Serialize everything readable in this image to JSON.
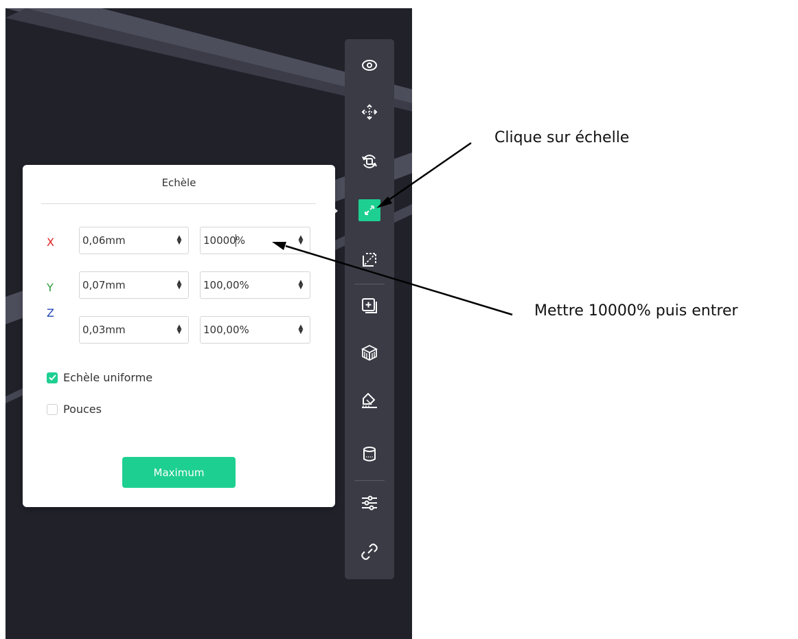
{
  "colors": {
    "accent": "#1ecf92",
    "viewport_bg": "#202129",
    "toolbar_bg": "#3a3b45",
    "axis_x": "#e02020",
    "axis_y": "#2a9a3a",
    "axis_z": "#2248b8"
  },
  "toolbar": {
    "tools": [
      {
        "name": "view",
        "icon": "eye-icon"
      },
      {
        "name": "move",
        "icon": "move-arrows-icon"
      },
      {
        "name": "rotate",
        "icon": "rotate-icon"
      },
      {
        "name": "scale",
        "icon": "scale-icon",
        "active": true
      },
      {
        "name": "mirror",
        "icon": "mirror-icon"
      },
      {
        "name": "add-part",
        "icon": "add-part-icon"
      },
      {
        "name": "supports",
        "icon": "supports-cube-icon"
      },
      {
        "name": "lay-flat",
        "icon": "lay-flat-icon"
      },
      {
        "name": "cylinder",
        "icon": "cylinder-icon"
      },
      {
        "name": "settings",
        "icon": "sliders-icon"
      },
      {
        "name": "link",
        "icon": "link-icon"
      }
    ]
  },
  "scale_panel": {
    "title": "Echèle",
    "rows": [
      {
        "axis": "X",
        "size": "0,06mm",
        "percent_before_caret": "10000",
        "percent_after_caret": "%"
      },
      {
        "axis": "Y",
        "size": "0,07mm",
        "percent": "100,00%"
      },
      {
        "axis": "Z",
        "size": "0,03mm",
        "percent": "100,00%"
      }
    ],
    "uniform_scale": {
      "label": "Echèle uniforme",
      "checked": true
    },
    "inches": {
      "label": "Pouces",
      "checked": false
    },
    "maximum_button": "Maximum"
  },
  "annotations": {
    "click_scale": "Clique sur échelle",
    "set_value": "Mettre 10000% puis entrer"
  }
}
